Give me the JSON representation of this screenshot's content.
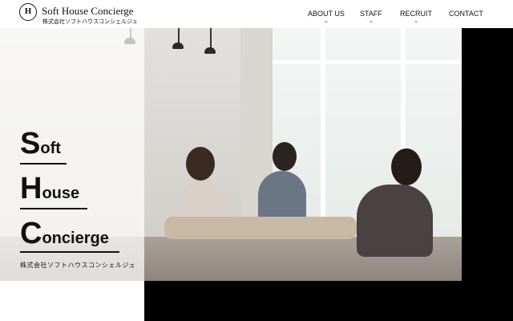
{
  "header": {
    "logo_mark": "H",
    "company_name": "Soft House Concierge",
    "company_name_ja": "株式会社ソフトハウスコンシェルジュ",
    "nav": [
      {
        "label": "ABOUT US",
        "has_dropdown": true,
        "dropdown_icon": "chevron-down-icon"
      },
      {
        "label": "STAFF",
        "has_dropdown": true,
        "dropdown_icon": "chevron-down-icon"
      },
      {
        "label": "RECRUIT",
        "has_dropdown": true,
        "dropdown_icon": "chevron-down-icon"
      },
      {
        "label": "CONTACT",
        "has_dropdown": false
      }
    ]
  },
  "hero": {
    "words": [
      {
        "cap": "S",
        "rest": "oft"
      },
      {
        "cap": "H",
        "rest": "ouse"
      },
      {
        "cap": "C",
        "rest": "oncierge"
      }
    ],
    "subtitle": "株式会社ソフトハウスコンシェルジュ"
  },
  "colors": {
    "text": "#111111",
    "overlay": "#ffffff",
    "block": "#000000"
  }
}
